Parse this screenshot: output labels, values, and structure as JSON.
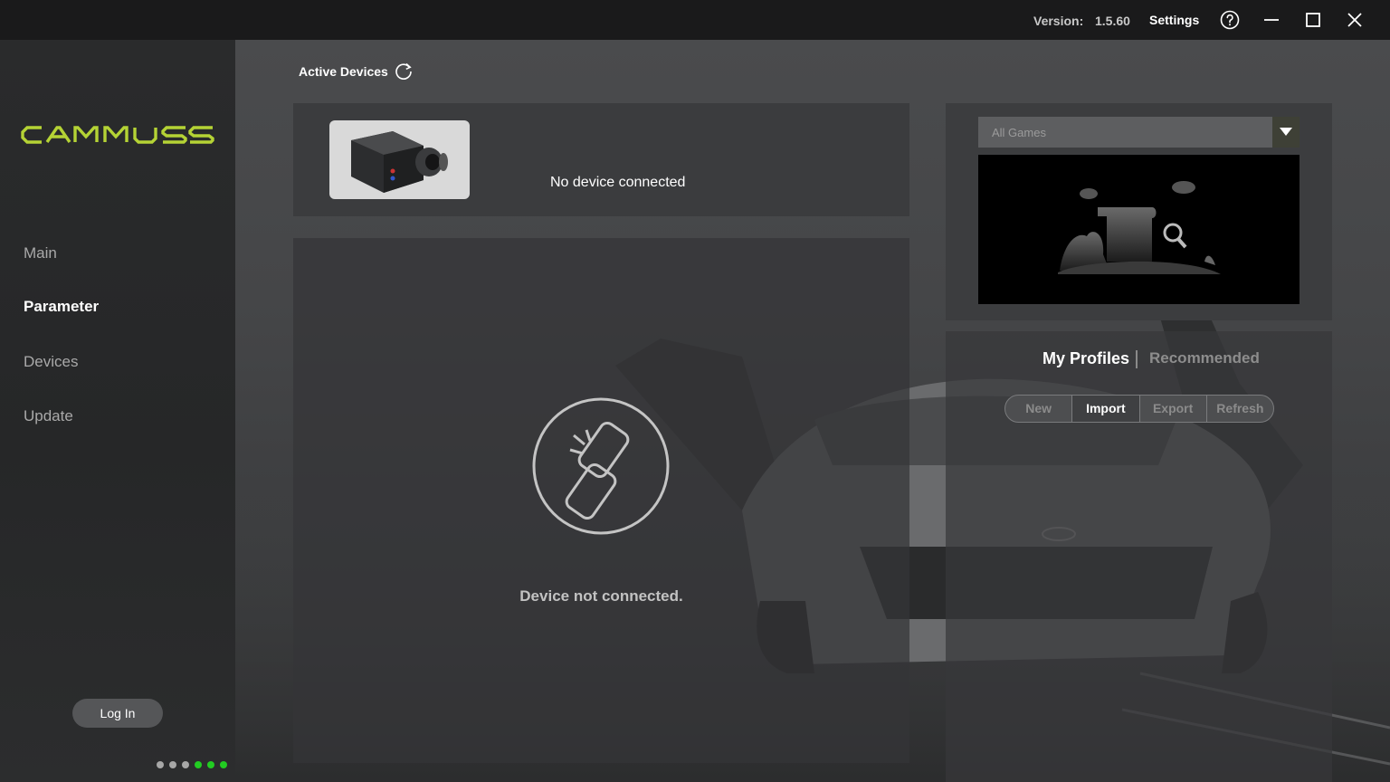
{
  "titlebar": {
    "version_label": "Version:",
    "version_value": "1.5.60",
    "settings_label": "Settings"
  },
  "sidebar": {
    "logo_text": "CAMMUS",
    "items": [
      {
        "label": "Main",
        "active": false
      },
      {
        "label": "Parameter",
        "active": true
      },
      {
        "label": "Devices",
        "active": false
      },
      {
        "label": "Update",
        "active": false
      }
    ],
    "login_label": "Log In",
    "page_dots": [
      "inactive",
      "inactive",
      "inactive",
      "active",
      "active",
      "active"
    ]
  },
  "main": {
    "active_devices_label": "Active Devices",
    "device_status": "No device connected",
    "connection_message": "Device not connected.",
    "games_select": {
      "value": "All Games"
    },
    "profiles": {
      "tabs": [
        {
          "label": "My Profiles",
          "active": true
        },
        {
          "label": "Recommended",
          "active": false
        }
      ],
      "buttons": [
        "New",
        "Import",
        "Export",
        "Refresh"
      ]
    }
  },
  "colors": {
    "brand_green": "#b5d335",
    "status_green": "#22cc22"
  }
}
